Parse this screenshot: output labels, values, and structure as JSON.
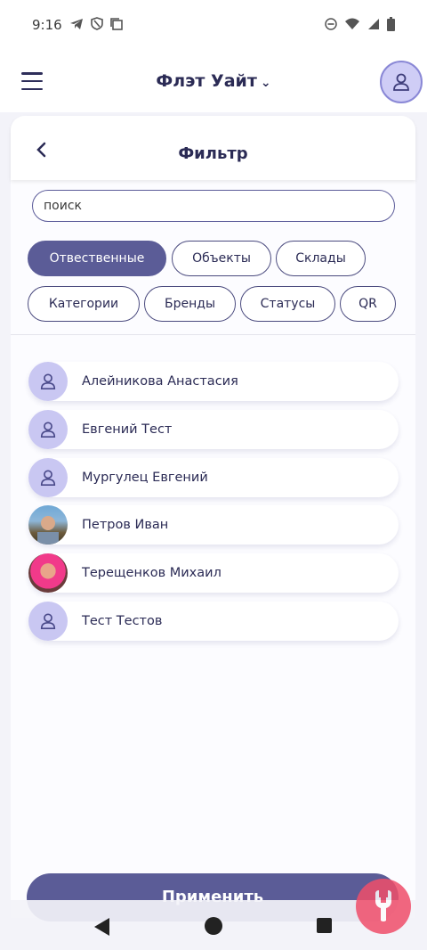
{
  "status_bar": {
    "time": "9:16",
    "left_icons": [
      "telegram-icon",
      "shield-icon",
      "copy-icon"
    ],
    "right_icons": [
      "dnd-icon",
      "wifi-icon",
      "signal-icon",
      "battery-icon"
    ]
  },
  "header": {
    "title": "Флэт Уайт",
    "menu_icon": "hamburger-icon",
    "dropdown_icon": "chevron-down-icon",
    "profile_icon": "user-icon"
  },
  "filter": {
    "title": "Фильтр",
    "back_icon": "chevron-left-icon",
    "search": {
      "placeholder": "поиск",
      "value": ""
    },
    "chips": [
      {
        "label": "Отвественные",
        "active": true
      },
      {
        "label": "Объекты",
        "active": false
      },
      {
        "label": "Склады",
        "active": false
      },
      {
        "label": "Категории",
        "active": false
      },
      {
        "label": "Бренды",
        "active": false
      },
      {
        "label": "Статусы",
        "active": false
      },
      {
        "label": "QR",
        "active": false
      }
    ],
    "people": [
      {
        "name": "Алейникова Анастасия",
        "avatar": "user-icon"
      },
      {
        "name": "Евгений Тест",
        "avatar": "user-icon"
      },
      {
        "name": "Мургулец Евгений",
        "avatar": "user-icon"
      },
      {
        "name": "Петров Иван",
        "avatar": "photo"
      },
      {
        "name": "Терещенков Михаил",
        "avatar": "photo"
      },
      {
        "name": "Тест Тестов",
        "avatar": "user-icon"
      }
    ],
    "apply_label": "Применить"
  },
  "colors": {
    "accent": "#5b5c97",
    "avatar_bg": "#c9c7f2",
    "fab": "#f04e6a"
  },
  "nav": {
    "icons": [
      "back-triangle-icon",
      "home-circle-icon",
      "recent-square-icon"
    ]
  }
}
